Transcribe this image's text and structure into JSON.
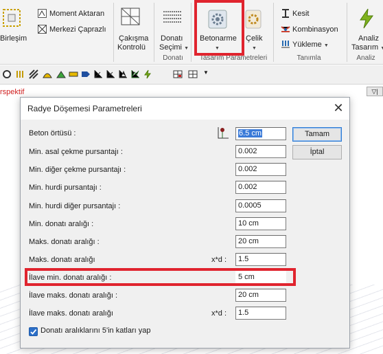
{
  "ribbon": {
    "birlesim": "Birleşim",
    "moment_aktaran": "Moment Aktaran",
    "merkezi_capraz": "Merkezi Çaprazlı",
    "cakisma": "Çakışma",
    "kontrolu": "Kontrolü",
    "donati": "Donatı",
    "secimi": "Seçimi",
    "donati_group": "Donatı",
    "betonarme": "Betonarme",
    "celik": "Çelik",
    "tasarim_group": "Tasarım Parametreleri",
    "kesit": "Kesit",
    "kombinasyon": "Kombinasyon",
    "yukleme": "Yükleme",
    "tanimla_group": "Tanımla",
    "analiz": "Analiz",
    "tasarim": "Tasarım",
    "analiz_group": "Analiz"
  },
  "viewport": {
    "perspective_label": "rspektif"
  },
  "dialog": {
    "title": "Radye Döşemesi Parametreleri",
    "ok_label": "Tamam",
    "cancel_label": "İptal",
    "xd_label": "x*d :",
    "rows": [
      {
        "label": "Beton örtüsü :",
        "value": "6.5 cm"
      },
      {
        "label": "Min. asal çekme pursantajı :",
        "value": "0.002"
      },
      {
        "label": "Min. diğer çekme pursantajı :",
        "value": "0.002"
      },
      {
        "label": "Min. hurdi pursantajı :",
        "value": "0.002"
      },
      {
        "label": "Min. hurdi diğer pursantajı :",
        "value": "0.0005"
      },
      {
        "label": "Min. donatı aralığı :",
        "value": "10 cm"
      },
      {
        "label": "Maks. donatı aralığı :",
        "value": "20 cm"
      },
      {
        "label": "Maks. donatı aralığı",
        "value": "1.5"
      },
      {
        "label": "İlave min. donatı aralığı :",
        "value": "5 cm"
      },
      {
        "label": "İlave maks. donatı aralığı :",
        "value": "20 cm"
      },
      {
        "label": "İlave maks. donatı aralığı",
        "value": "1.5"
      }
    ],
    "checkbox_label": "Donatı aralıklarını 5'in katları yap",
    "checkbox_checked": true
  },
  "colors": {
    "highlight": "#e0242e",
    "accent": "#2d7bd4"
  }
}
